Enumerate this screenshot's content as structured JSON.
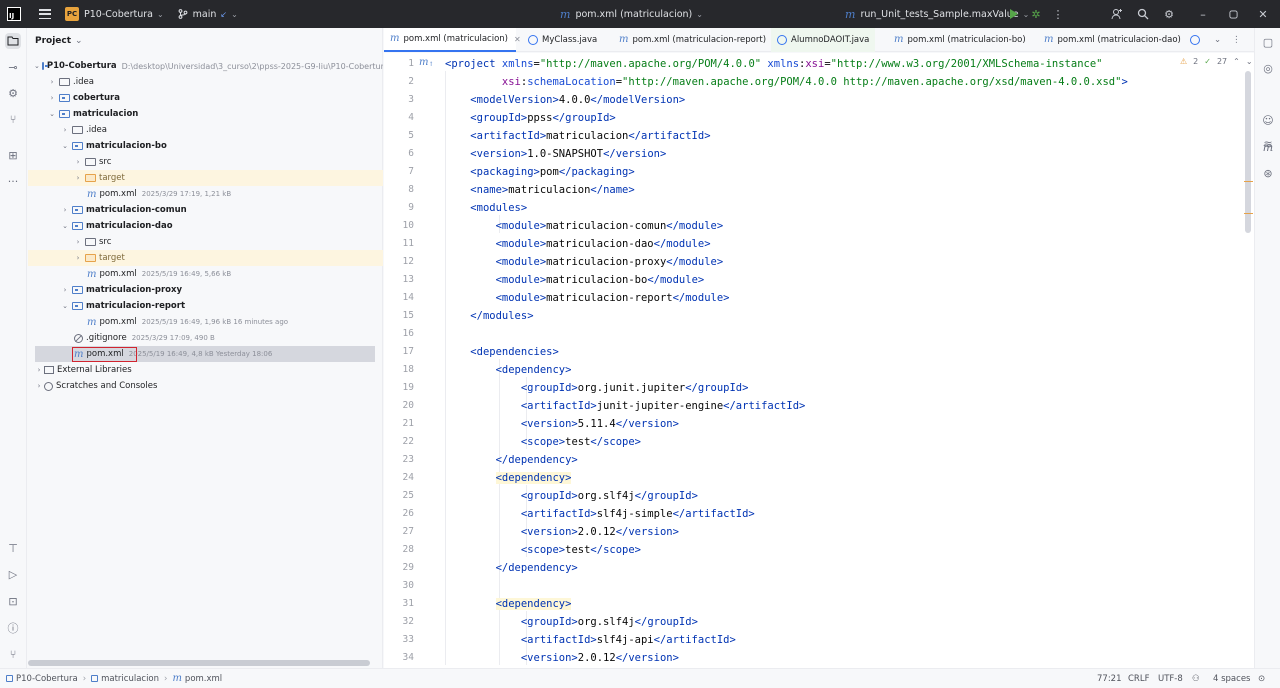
{
  "titlebar": {
    "logo_text": "IJ",
    "project_badge": "PC",
    "project_name": "P10-Cobertura",
    "branch": "main",
    "center_file": "pom.xml (matriculacion)",
    "run_config": "run_Unit_tests_Sample.maxValue"
  },
  "project_panel": {
    "title": "Project",
    "rows": [
      {
        "name": "P10-Cobertura",
        "path": "D:\\desktop\\Universidad\\3_curso\\2\\ppss-2025-G9-liu\\P10-Cobertura"
      },
      {
        "name": ".idea"
      },
      {
        "name": "cobertura"
      },
      {
        "name": "matriculacion"
      },
      {
        "name": ".idea"
      },
      {
        "name": "matriculacion-bo"
      },
      {
        "name": "src"
      },
      {
        "name": "target"
      },
      {
        "name": "pom.xml",
        "meta": "2025/3/29 17:19, 1,21 kB"
      },
      {
        "name": "matriculacion-comun"
      },
      {
        "name": "matriculacion-dao"
      },
      {
        "name": "src"
      },
      {
        "name": "target"
      },
      {
        "name": "pom.xml",
        "meta": "2025/5/19 16:49, 5,66 kB"
      },
      {
        "name": "matriculacion-proxy"
      },
      {
        "name": "matriculacion-report"
      },
      {
        "name": "pom.xml",
        "meta": "2025/5/19 16:49, 1,96 kB 16 minutes ago"
      },
      {
        "name": ".gitignore",
        "meta": "2025/3/29 17:09, 490 B"
      },
      {
        "name": "pom.xml",
        "meta": "2025/5/19 16:49, 4,8 kB Yesterday 18:06"
      },
      {
        "name": "External Libraries"
      },
      {
        "name": "Scratches and Consoles"
      }
    ]
  },
  "tabs": [
    {
      "label": "pom.xml (matriculacion)"
    },
    {
      "label": "MyClass.java"
    },
    {
      "label": "pom.xml (matriculacion-report)"
    },
    {
      "label": "AlumnoDAOIT.java"
    },
    {
      "label": "pom.xml (matriculacion-bo)"
    },
    {
      "label": "pom.xml (matriculacion-dao)"
    }
  ],
  "inspections": {
    "warnings": "2",
    "ok": "27"
  },
  "editor": {
    "line_numbers": [
      "1",
      "2",
      "3",
      "4",
      "5",
      "6",
      "7",
      "8",
      "9",
      "10",
      "11",
      "12",
      "13",
      "14",
      "15",
      "16",
      "17",
      "18",
      "19",
      "20",
      "21",
      "22",
      "23",
      "24",
      "25",
      "26",
      "27",
      "28",
      "29",
      "30",
      "31",
      "32",
      "33",
      "34"
    ],
    "lines": [
      [
        {
          "c": "tg",
          "t": "<project "
        },
        {
          "c": "at",
          "t": "xmlns"
        },
        {
          "c": "tx",
          "t": "="
        },
        {
          "c": "sv",
          "t": "\"http://maven.apache.org/POM/4.0.0\" "
        },
        {
          "c": "at",
          "t": "xmlns"
        },
        {
          "c": "tx",
          "t": ":"
        },
        {
          "c": "ns",
          "t": "xsi"
        },
        {
          "c": "tx",
          "t": "="
        },
        {
          "c": "sv",
          "t": "\"http://www.w3.org/2001/XMLSchema-instance\""
        }
      ],
      [
        {
          "c": "tx",
          "t": "         "
        },
        {
          "c": "ns",
          "t": "xsi"
        },
        {
          "c": "tx",
          "t": ":"
        },
        {
          "c": "at",
          "t": "schemaLocation"
        },
        {
          "c": "tx",
          "t": "="
        },
        {
          "c": "sv",
          "t": "\"http://maven.apache.org/POM/4.0.0 http://maven.apache.org/xsd/maven-4.0.0.xsd\""
        },
        {
          "c": "tg",
          "t": ">"
        }
      ],
      [
        {
          "c": "tx",
          "t": "    "
        },
        {
          "c": "tg",
          "t": "<modelVersion>"
        },
        {
          "c": "tx",
          "t": "4.0.0"
        },
        {
          "c": "tg",
          "t": "</modelVersion>"
        }
      ],
      [
        {
          "c": "tx",
          "t": "    "
        },
        {
          "c": "tg",
          "t": "<groupId>"
        },
        {
          "c": "tx",
          "t": "ppss"
        },
        {
          "c": "tg",
          "t": "</groupId>"
        }
      ],
      [
        {
          "c": "tx",
          "t": "    "
        },
        {
          "c": "tg",
          "t": "<artifactId>"
        },
        {
          "c": "tx",
          "t": "matriculacion"
        },
        {
          "c": "tg",
          "t": "</artifactId>"
        }
      ],
      [
        {
          "c": "tx",
          "t": "    "
        },
        {
          "c": "tg",
          "t": "<version>"
        },
        {
          "c": "tx",
          "t": "1.0-SNAPSHOT"
        },
        {
          "c": "tg",
          "t": "</version>"
        }
      ],
      [
        {
          "c": "tx",
          "t": "    "
        },
        {
          "c": "tg",
          "t": "<packaging>"
        },
        {
          "c": "tx",
          "t": "pom"
        },
        {
          "c": "tg",
          "t": "</packaging>"
        }
      ],
      [
        {
          "c": "tx",
          "t": "    "
        },
        {
          "c": "tg",
          "t": "<name>"
        },
        {
          "c": "tx",
          "t": "matriculacion"
        },
        {
          "c": "tg",
          "t": "</name>"
        }
      ],
      [
        {
          "c": "tx",
          "t": "    "
        },
        {
          "c": "tg",
          "t": "<modules>"
        }
      ],
      [
        {
          "c": "tx",
          "t": "        "
        },
        {
          "c": "tg",
          "t": "<module>"
        },
        {
          "c": "tx",
          "t": "matriculacion-comun"
        },
        {
          "c": "tg",
          "t": "</module>"
        }
      ],
      [
        {
          "c": "tx",
          "t": "        "
        },
        {
          "c": "tg",
          "t": "<module>"
        },
        {
          "c": "tx",
          "t": "matriculacion-dao"
        },
        {
          "c": "tg",
          "t": "</module>"
        }
      ],
      [
        {
          "c": "tx",
          "t": "        "
        },
        {
          "c": "tg",
          "t": "<module>"
        },
        {
          "c": "tx",
          "t": "matriculacion-proxy"
        },
        {
          "c": "tg",
          "t": "</module>"
        }
      ],
      [
        {
          "c": "tx",
          "t": "        "
        },
        {
          "c": "tg",
          "t": "<module>"
        },
        {
          "c": "tx",
          "t": "matriculacion-bo"
        },
        {
          "c": "tg",
          "t": "</module>"
        }
      ],
      [
        {
          "c": "tx",
          "t": "        "
        },
        {
          "c": "tg",
          "t": "<module>"
        },
        {
          "c": "tx",
          "t": "matriculacion-report"
        },
        {
          "c": "tg",
          "t": "</module>"
        }
      ],
      [
        {
          "c": "tx",
          "t": "    "
        },
        {
          "c": "tg",
          "t": "</modules>"
        }
      ],
      [],
      [
        {
          "c": "tx",
          "t": "    "
        },
        {
          "c": "tg",
          "t": "<dependencies>"
        }
      ],
      [
        {
          "c": "tx",
          "t": "        "
        },
        {
          "c": "tg",
          "t": "<dependency>"
        }
      ],
      [
        {
          "c": "tx",
          "t": "            "
        },
        {
          "c": "tg",
          "t": "<groupId>"
        },
        {
          "c": "tx",
          "t": "org.junit.jupiter"
        },
        {
          "c": "tg",
          "t": "</groupId>"
        }
      ],
      [
        {
          "c": "tx",
          "t": "            "
        },
        {
          "c": "tg",
          "t": "<artifactId>"
        },
        {
          "c": "tx",
          "t": "junit-jupiter-engine"
        },
        {
          "c": "tg",
          "t": "</artifactId>"
        }
      ],
      [
        {
          "c": "tx",
          "t": "            "
        },
        {
          "c": "tg",
          "t": "<version>"
        },
        {
          "c": "tx",
          "t": "5.11.4"
        },
        {
          "c": "tg",
          "t": "</version>"
        }
      ],
      [
        {
          "c": "tx",
          "t": "            "
        },
        {
          "c": "tg",
          "t": "<scope>"
        },
        {
          "c": "tx",
          "t": "test"
        },
        {
          "c": "tg",
          "t": "</scope>"
        }
      ],
      [
        {
          "c": "tx",
          "t": "        "
        },
        {
          "c": "tg",
          "t": "</dependency>"
        }
      ],
      [
        {
          "c": "tx",
          "t": "        "
        },
        {
          "c": "tg mark",
          "t": "<dependency>"
        }
      ],
      [
        {
          "c": "tx",
          "t": "            "
        },
        {
          "c": "tg",
          "t": "<groupId>"
        },
        {
          "c": "tx",
          "t": "org.slf4j"
        },
        {
          "c": "tg",
          "t": "</groupId>"
        }
      ],
      [
        {
          "c": "tx",
          "t": "            "
        },
        {
          "c": "tg",
          "t": "<artifactId>"
        },
        {
          "c": "tx",
          "t": "slf4j-simple"
        },
        {
          "c": "tg",
          "t": "</artifactId>"
        }
      ],
      [
        {
          "c": "tx",
          "t": "            "
        },
        {
          "c": "tg",
          "t": "<version>"
        },
        {
          "c": "tx",
          "t": "2.0.12"
        },
        {
          "c": "tg",
          "t": "</version>"
        }
      ],
      [
        {
          "c": "tx",
          "t": "            "
        },
        {
          "c": "tg",
          "t": "<scope>"
        },
        {
          "c": "tx",
          "t": "test"
        },
        {
          "c": "tg",
          "t": "</scope>"
        }
      ],
      [
        {
          "c": "tx",
          "t": "        "
        },
        {
          "c": "tg",
          "t": "</dependency>"
        }
      ],
      [],
      [
        {
          "c": "tx",
          "t": "        "
        },
        {
          "c": "tg mark",
          "t": "<dependency>"
        }
      ],
      [
        {
          "c": "tx",
          "t": "            "
        },
        {
          "c": "tg",
          "t": "<groupId>"
        },
        {
          "c": "tx",
          "t": "org.slf4j"
        },
        {
          "c": "tg",
          "t": "</groupId>"
        }
      ],
      [
        {
          "c": "tx",
          "t": "            "
        },
        {
          "c": "tg",
          "t": "<artifactId>"
        },
        {
          "c": "tx",
          "t": "slf4j-api"
        },
        {
          "c": "tg",
          "t": "</artifactId>"
        }
      ],
      [
        {
          "c": "tx",
          "t": "            "
        },
        {
          "c": "tg",
          "t": "<version>"
        },
        {
          "c": "tx",
          "t": "2.0.12"
        },
        {
          "c": "tg",
          "t": "</version>"
        }
      ]
    ]
  },
  "statusbar": {
    "breadcrumb": [
      "P10-Cobertura",
      "matriculacion",
      "pom.xml"
    ],
    "position": "77:21",
    "line_sep": "CRLF",
    "encoding": "UTF-8",
    "indent": "4 spaces"
  },
  "colors": {
    "accent": "#3574f0",
    "maven": "#4e7ec9",
    "target_folder": "#fdf5e0"
  }
}
